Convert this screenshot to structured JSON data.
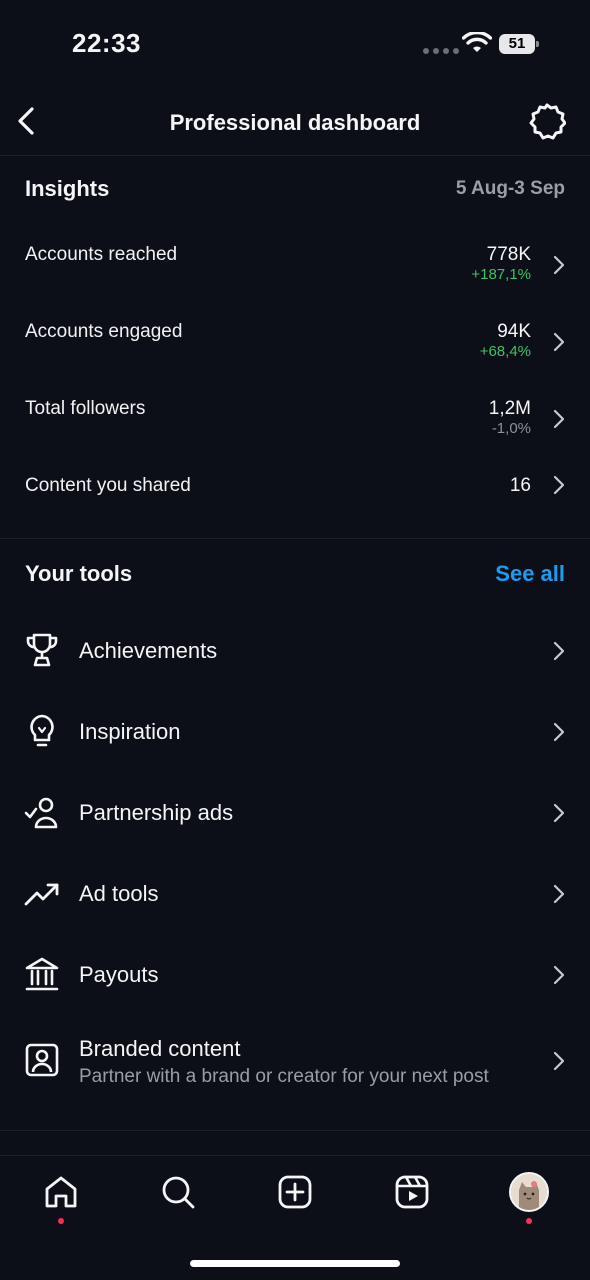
{
  "status_bar": {
    "time": "22:33",
    "battery": "51"
  },
  "header": {
    "title": "Professional dashboard"
  },
  "insights": {
    "title": "Insights",
    "date_range": "5 Aug-3 Sep",
    "metrics": [
      {
        "label": "Accounts reached",
        "value": "778K",
        "change": "+187,1%"
      },
      {
        "label": "Accounts engaged",
        "value": "94K",
        "change": "+68,4%"
      },
      {
        "label": "Total followers",
        "value": "1,2M",
        "change": "-1,0%"
      },
      {
        "label": "Content you shared",
        "value": "16"
      }
    ]
  },
  "tools": {
    "title": "Your tools",
    "see_all": "See all",
    "items": [
      {
        "label": "Achievements",
        "icon": "trophy-icon"
      },
      {
        "label": "Inspiration",
        "icon": "lightbulb-icon"
      },
      {
        "label": "Partnership ads",
        "icon": "partnership-icon"
      },
      {
        "label": "Ad tools",
        "icon": "trending-up-icon"
      },
      {
        "label": "Payouts",
        "icon": "bank-icon"
      },
      {
        "label": "Branded content",
        "subtitle": "Partner with a brand or creator for your next post",
        "icon": "branded-content-icon"
      }
    ]
  },
  "nav": {
    "items": [
      "home-icon",
      "search-icon",
      "create-icon",
      "reels-icon",
      "profile-avatar"
    ]
  },
  "colors": {
    "background": "#0c0f17",
    "positive": "#3ac364",
    "link": "#1d9bf0",
    "notification_dot": "#ff2d55"
  }
}
